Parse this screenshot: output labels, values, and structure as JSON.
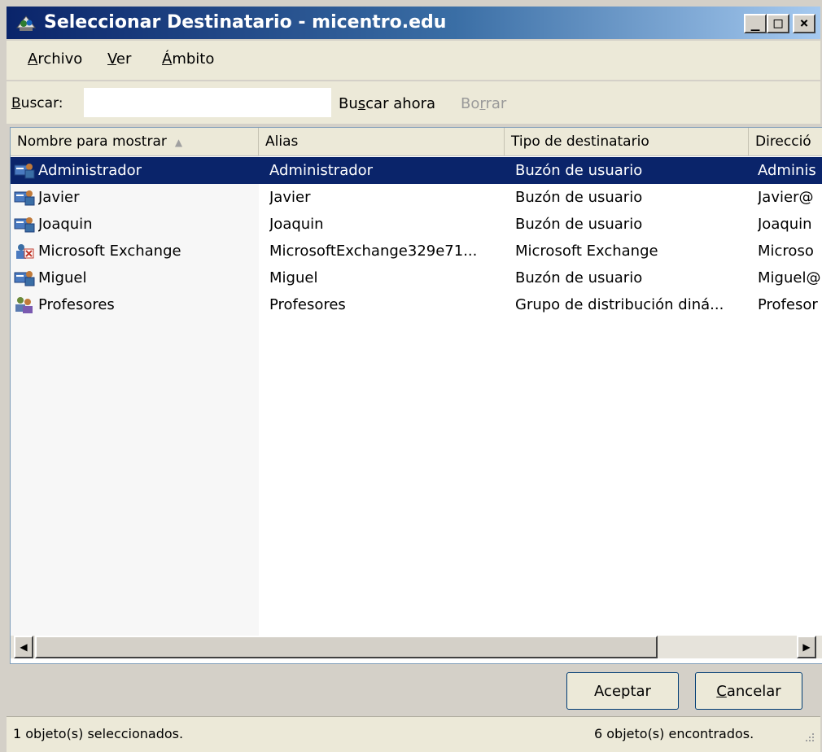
{
  "window": {
    "title": "Seleccionar Destinatario - micentro.edu",
    "icon": "address-book-icon",
    "controls": {
      "minimize": "_",
      "maximize": "□",
      "close": "×"
    }
  },
  "menu": {
    "items": [
      {
        "mnemonic": "A",
        "rest": "rchivo"
      },
      {
        "mnemonic": "V",
        "rest": "er"
      },
      {
        "mnemonic": "Á",
        "rest": "mbito"
      }
    ]
  },
  "search": {
    "label_mnemonic": "B",
    "label_rest": "uscar:",
    "value": "",
    "find_now_pre": "Bu",
    "find_now_mnemonic": "s",
    "find_now_post": "car ahora",
    "clear_pre": "Bo",
    "clear_mnemonic": "r",
    "clear_post": "rar"
  },
  "columns": [
    "Nombre para mostrar",
    "Alias",
    "Tipo de destinatario",
    "Direcció"
  ],
  "sort_indicator": "▲",
  "rows": [
    {
      "name": "Administrador",
      "alias": "Administrador",
      "type": "Buzón de usuario",
      "address": "Adminis",
      "icon": "user-mailbox-icon",
      "selected": true
    },
    {
      "name": "Javier",
      "alias": "Javier",
      "type": "Buzón de usuario",
      "address": "Javier@",
      "icon": "user-mailbox-icon",
      "selected": false
    },
    {
      "name": "Joaquin",
      "alias": "Joaquin",
      "type": "Buzón de usuario",
      "address": "Joaquin",
      "icon": "user-mailbox-icon",
      "selected": false
    },
    {
      "name": "Microsoft Exchange",
      "alias": "MicrosoftExchange329e71...",
      "type": "Microsoft Exchange",
      "address": "Microso",
      "icon": "exchange-system-icon",
      "selected": false
    },
    {
      "name": "Miguel",
      "alias": "Miguel",
      "type": "Buzón de usuario",
      "address": "Miguel@",
      "icon": "user-mailbox-icon",
      "selected": false
    },
    {
      "name": "Profesores",
      "alias": "Profesores",
      "type": "Grupo de distribución diná...",
      "address": "Profesor",
      "icon": "group-icon",
      "selected": false
    }
  ],
  "scrollbar": {
    "left_arrow": "◀",
    "right_arrow": "▶"
  },
  "buttons": {
    "ok": "Aceptar",
    "cancel_mnemonic": "C",
    "cancel_rest": "ancelar"
  },
  "status": {
    "selected": "1 objeto(s) seleccionados.",
    "found": "6 objeto(s) encontrados."
  },
  "colors": {
    "selection": "#0a246a",
    "title_start": "#0a246a",
    "title_end": "#a6caf0",
    "disabled_text": "#9a9a9a"
  }
}
